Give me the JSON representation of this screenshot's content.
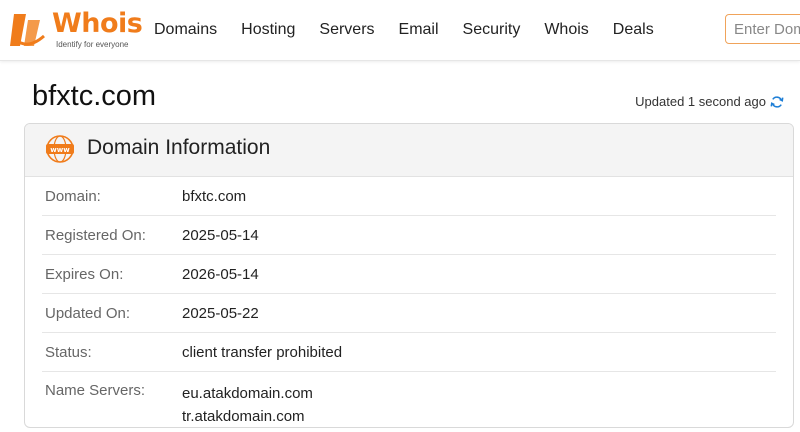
{
  "header": {
    "logo_text": "Whois",
    "logo_tagline": "Identify for everyone",
    "nav": [
      "Domains",
      "Hosting",
      "Servers",
      "Email",
      "Security",
      "Whois",
      "Deals"
    ],
    "search_placeholder": "Enter Domain"
  },
  "page": {
    "title": "bfxtc.com",
    "updated_text": "Updated 1 second ago"
  },
  "card": {
    "title": "Domain Information",
    "icon": "www-icon",
    "rows": [
      {
        "label": "Domain:",
        "value": "bfxtc.com"
      },
      {
        "label": "Registered On:",
        "value": "2025-05-14"
      },
      {
        "label": "Expires On:",
        "value": "2026-05-14"
      },
      {
        "label": "Updated On:",
        "value": "2025-05-22"
      },
      {
        "label": "Status:",
        "value": "client transfer prohibited"
      }
    ],
    "name_servers": {
      "label": "Name Servers:",
      "values": [
        "eu.atakdomain.com",
        "tr.atakdomain.com"
      ]
    }
  },
  "colors": {
    "brand": "#f07c1b",
    "refresh": "#1f7fd6"
  }
}
